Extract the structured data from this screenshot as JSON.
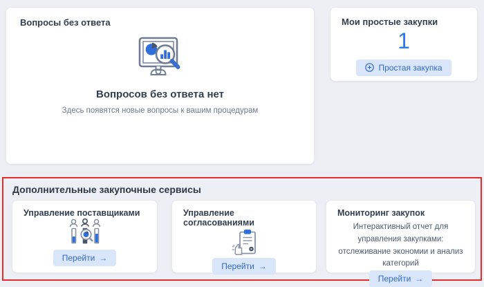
{
  "colors": {
    "page_bg": "#edeff4",
    "accent_blue": "#2f6fdb",
    "count_blue": "#2e79ea",
    "button_bg": "#d9e5f9",
    "button_text": "#3169cc",
    "highlight_red": "#e32d2d",
    "heading_text": "#313e4f",
    "muted_text": "#6e7a8b"
  },
  "questions_card": {
    "title": "Вопросы без ответа",
    "illustration": "monitor-analytics-icon",
    "empty_title": "Вопросов без ответа нет",
    "empty_subtitle": "Здесь появятся новые вопросы к вашим процедурам"
  },
  "purchases_card": {
    "title": "Мои простые закупки",
    "count": "1",
    "button": {
      "icon": "plus-circle-icon",
      "label": "Простая закупка"
    }
  },
  "services_section": {
    "title": "Дополнительные закупочные сервисы",
    "cards": [
      {
        "title": "Управление поставщиками",
        "icon": "suppliers-audit-icon",
        "button": {
          "label": "Перейти",
          "arrow": "→"
        }
      },
      {
        "title": "Управление согласованиями",
        "icon": "approvals-clipboard-icon",
        "button": {
          "label": "Перейти",
          "arrow": "→"
        }
      },
      {
        "title": "Мониторинг закупок",
        "description": "Интерактивный отчет для управления закупками: отслеживание экономии и анализ категорий",
        "button": {
          "label": "Перейти",
          "arrow": "→"
        }
      }
    ]
  }
}
